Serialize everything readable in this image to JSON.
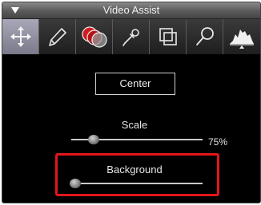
{
  "window": {
    "title": "Video Assist"
  },
  "toolbar": {
    "tools": [
      {
        "icon": "move-arrows-icon",
        "active": true
      },
      {
        "icon": "pencil-icon",
        "active": false
      },
      {
        "icon": "overlap-circles-icon",
        "active": false
      },
      {
        "icon": "eyedropper-icon",
        "active": false
      },
      {
        "icon": "overlay-squares-icon",
        "active": false
      },
      {
        "icon": "magnifier-icon",
        "active": false
      },
      {
        "icon": "histogram-icon",
        "active": false
      }
    ]
  },
  "controls": {
    "center_label": "Center",
    "scale": {
      "label": "Scale",
      "value_text": "75%",
      "position_fraction": 0.17
    },
    "background": {
      "label": "Background",
      "position_fraction": 0.03
    }
  },
  "colors": {
    "panel_bg": "#000000",
    "active_tool": "#9a9aac",
    "highlight": "#e3161b",
    "track": "#c8c8c8"
  }
}
